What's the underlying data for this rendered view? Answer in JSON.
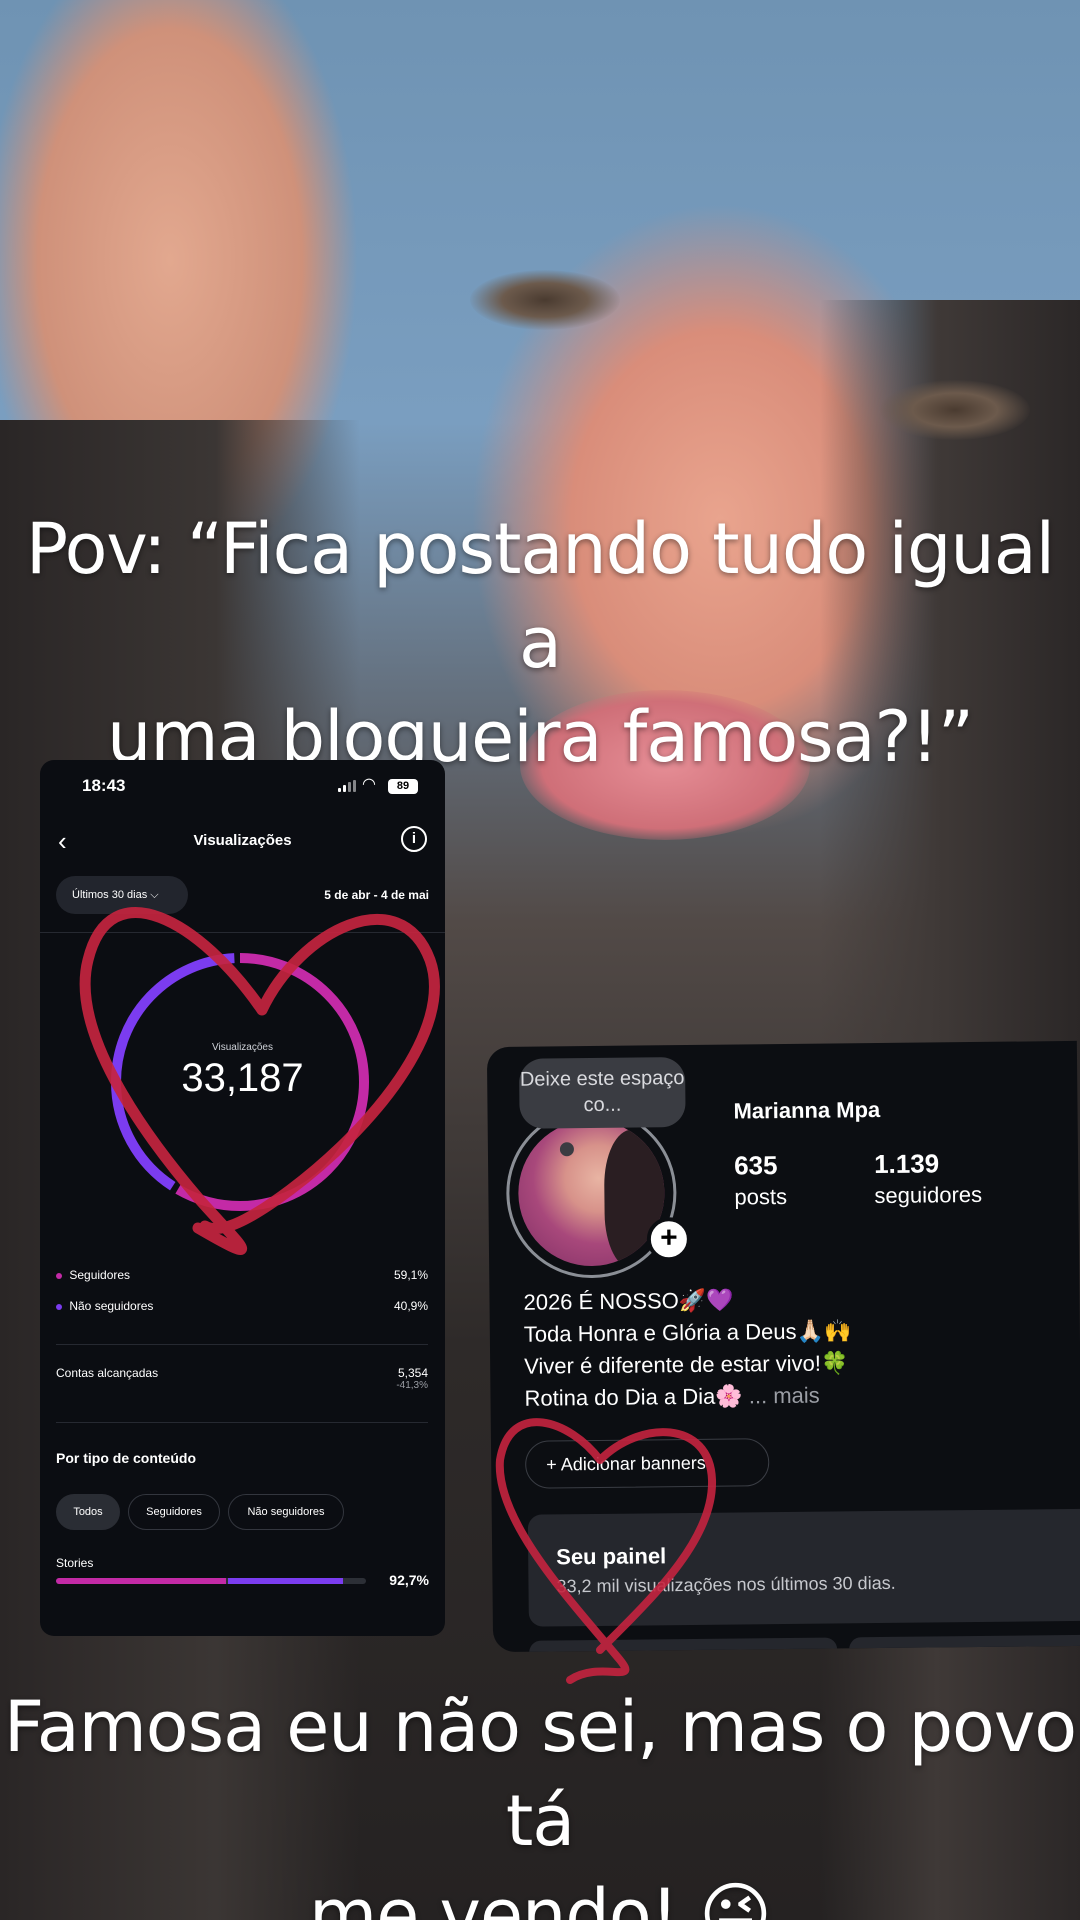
{
  "captions": {
    "top_line1": "Pov: “Fica postando tudo igual a",
    "top_line2": "uma blogueira famosa?!”",
    "bottom_line1": "Famosa eu não sei, mas o povo tá",
    "bottom_line2": "me vendo! 😜"
  },
  "insights": {
    "status": {
      "time": "18:43",
      "battery": "89"
    },
    "title": "Visualizações",
    "filter_label": "Últimos 30 dias",
    "date_range": "5 de abr - 4 de mai",
    "ring": {
      "label": "Visualizações",
      "value": "33,187",
      "followers_fraction": 0.591
    },
    "legend": [
      {
        "label": "Seguidores",
        "value": "59,1%",
        "color": "#c32aa6"
      },
      {
        "label": "Não seguidores",
        "value": "40,9%",
        "color": "#7b3cf0"
      }
    ],
    "reach": {
      "label": "Contas alcançadas",
      "value": "5,354",
      "change": "-41,3%"
    },
    "section_title": "Por tipo de conteúdo",
    "chips": [
      "Todos",
      "Seguidores",
      "Não seguidores"
    ],
    "stories": {
      "label": "Stories",
      "value": "92,7%",
      "fraction": 0.927,
      "followers_share": 0.591
    },
    "colors": {
      "followers": "#c32aa6",
      "non_followers": "#7b3cf0",
      "background": "#0b0d12"
    }
  },
  "profile": {
    "note": "Deixe este espaço co...",
    "name": "Marianna Mpa",
    "posts_count": "635",
    "posts_label": "posts",
    "followers_count": "1.139",
    "followers_label": "seguidores",
    "bio": [
      "2026 É NOSSO🚀💜",
      "Toda Honra e Glória a Deus🙏🏻🙌",
      "Viver é diferente de estar vivo!🍀",
      "Rotina do Dia a Dia🌸"
    ],
    "bio_ellipsis": "...",
    "bio_more": "mais",
    "banner_button": "Adicionar banners",
    "panel_title": "Seu painel",
    "panel_subtitle": "33,2 mil visualizações nos últimos 30 dias."
  },
  "decor": {
    "heart_color": "#c4243f"
  }
}
